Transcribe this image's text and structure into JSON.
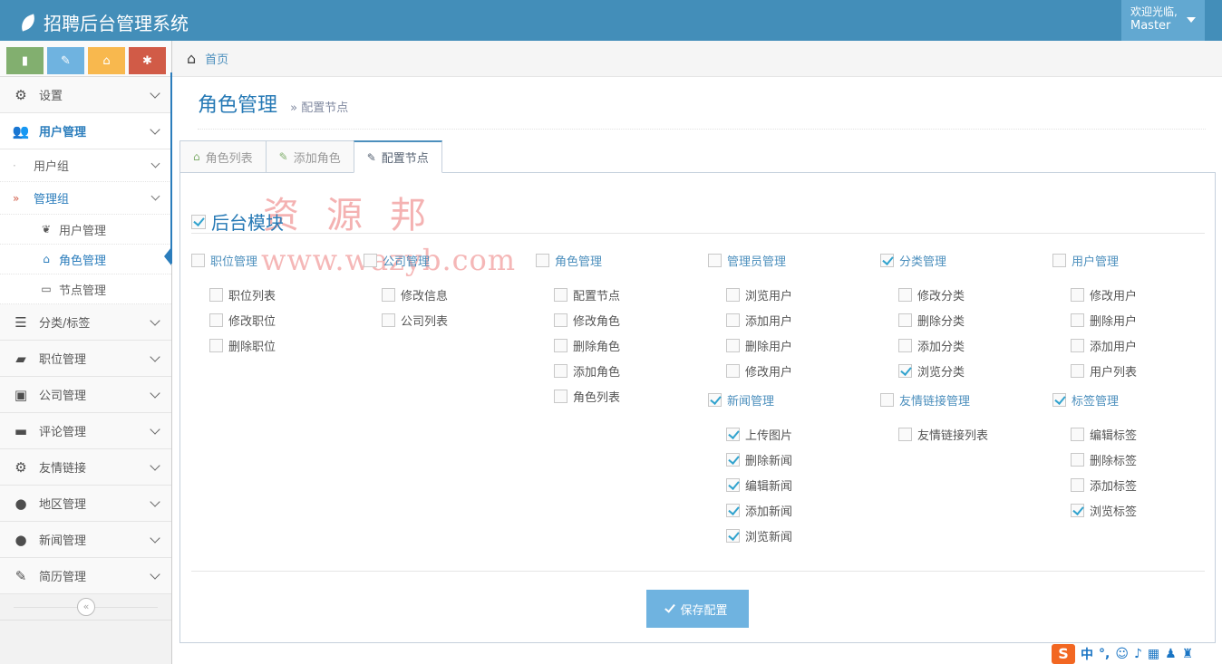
{
  "app": {
    "title": "招聘后台管理系统"
  },
  "user": {
    "line1": "欢迎光临,",
    "line2": "Master"
  },
  "sidebar": {
    "items": [
      {
        "label": "设置",
        "icon": "gear-icon"
      },
      {
        "label": "用户管理",
        "icon": "users-icon"
      },
      {
        "label": "分类/标签",
        "icon": "list-icon"
      },
      {
        "label": "职位管理",
        "icon": "book-icon"
      },
      {
        "label": "公司管理",
        "icon": "inbox-icon"
      },
      {
        "label": "评论管理",
        "icon": "desktop-icon"
      },
      {
        "label": "友情链接",
        "icon": "cogs-icon"
      },
      {
        "label": "地区管理",
        "icon": "globe-icon"
      },
      {
        "label": "新闻管理",
        "icon": "comment-icon"
      },
      {
        "label": "简历管理",
        "icon": "edit-icon"
      }
    ],
    "sub": {
      "user_group": "用户组",
      "manage_group": "管理组",
      "user_manage": "用户管理",
      "role_manage": "角色管理",
      "node_manage": "节点管理"
    },
    "collapse_glyph": "«"
  },
  "breadcrumb": {
    "home": "首页"
  },
  "page": {
    "title": "角色管理",
    "subtitle": "» 配置节点"
  },
  "tabs": [
    {
      "label": "角色列表"
    },
    {
      "label": "添加角色"
    },
    {
      "label": "配置节点"
    }
  ],
  "module": {
    "label": "后台模块",
    "checked": true
  },
  "groups": [
    {
      "name": "职位管理",
      "checked": false,
      "items": [
        {
          "label": "职位列表",
          "checked": false
        },
        {
          "label": "修改职位",
          "checked": false
        },
        {
          "label": "删除职位",
          "checked": false
        }
      ]
    },
    {
      "name": "公司管理",
      "checked": false,
      "items": [
        {
          "label": "修改信息",
          "checked": false
        },
        {
          "label": "公司列表",
          "checked": false
        }
      ]
    },
    {
      "name": "角色管理",
      "checked": false,
      "items": [
        {
          "label": "配置节点",
          "checked": false
        },
        {
          "label": "修改角色",
          "checked": false
        },
        {
          "label": "删除角色",
          "checked": false
        },
        {
          "label": "添加角色",
          "checked": false
        },
        {
          "label": "角色列表",
          "checked": false
        }
      ]
    },
    {
      "name": "管理员管理",
      "checked": false,
      "items": [
        {
          "label": "浏览用户",
          "checked": false
        },
        {
          "label": "添加用户",
          "checked": false
        },
        {
          "label": "删除用户",
          "checked": false
        },
        {
          "label": "修改用户",
          "checked": false
        }
      ]
    },
    {
      "name": "分类管理",
      "checked": true,
      "items": [
        {
          "label": "修改分类",
          "checked": false
        },
        {
          "label": "删除分类",
          "checked": false
        },
        {
          "label": "添加分类",
          "checked": false
        },
        {
          "label": "浏览分类",
          "checked": true
        }
      ]
    },
    {
      "name": "用户管理",
      "checked": false,
      "items": [
        {
          "label": "修改用户",
          "checked": false
        },
        {
          "label": "删除用户",
          "checked": false
        },
        {
          "label": "添加用户",
          "checked": false
        },
        {
          "label": "用户列表",
          "checked": false
        }
      ]
    },
    {
      "name": "新闻管理",
      "checked": true,
      "items": [
        {
          "label": "上传图片",
          "checked": true
        },
        {
          "label": "删除新闻",
          "checked": true
        },
        {
          "label": "编辑新闻",
          "checked": true
        },
        {
          "label": "添加新闻",
          "checked": true
        },
        {
          "label": "浏览新闻",
          "checked": true
        }
      ]
    },
    {
      "name": "友情链接管理",
      "checked": false,
      "items": [
        {
          "label": "友情链接列表",
          "checked": false
        }
      ]
    },
    {
      "name": "标签管理",
      "checked": true,
      "items": [
        {
          "label": "编辑标签",
          "checked": false
        },
        {
          "label": "删除标签",
          "checked": false
        },
        {
          "label": "添加标签",
          "checked": false
        },
        {
          "label": "浏览标签",
          "checked": true
        }
      ]
    }
  ],
  "save_button": {
    "label": "保存配置"
  },
  "watermark": {
    "line1": "资源邦",
    "line2": "www.wazyb.com"
  },
  "tray": {
    "ime": "S",
    "lang": "中"
  }
}
